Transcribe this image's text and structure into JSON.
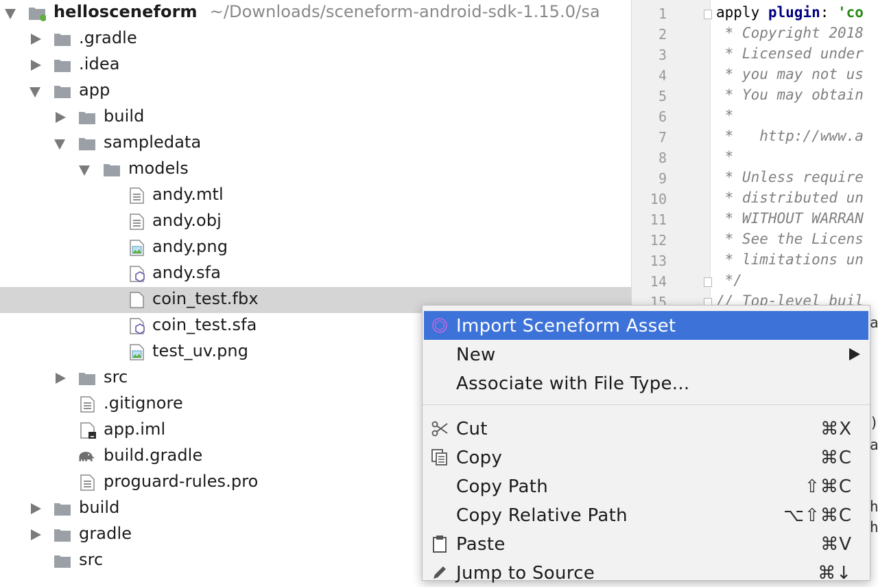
{
  "project_tree": {
    "root": {
      "name": "hellosceneform",
      "path": "~/Downloads/sceneform-android-sdk-1.15.0/sa"
    },
    "items": [
      {
        "label": ".gradle"
      },
      {
        "label": ".idea"
      },
      {
        "label": "app"
      },
      {
        "label": "build"
      },
      {
        "label": "sampledata"
      },
      {
        "label": "models"
      },
      {
        "label": "andy.mtl"
      },
      {
        "label": "andy.obj"
      },
      {
        "label": "andy.png"
      },
      {
        "label": "andy.sfa"
      },
      {
        "label": "coin_test.fbx"
      },
      {
        "label": "coin_test.sfa"
      },
      {
        "label": "test_uv.png"
      },
      {
        "label": "src"
      },
      {
        "label": ".gitignore"
      },
      {
        "label": "app.iml"
      },
      {
        "label": "build.gradle"
      },
      {
        "label": "proguard-rules.pro"
      },
      {
        "label": "build"
      },
      {
        "label": "gradle"
      },
      {
        "label": "src"
      }
    ]
  },
  "editor": {
    "line_numbers": [
      "1",
      "2",
      "3",
      "4",
      "5",
      "6",
      "7",
      "8",
      "9",
      "10",
      "11",
      "12",
      "13",
      "14",
      "15"
    ],
    "lines": [
      {
        "pre": "apply ",
        "kw": "plugin",
        "mid": ": ",
        "str": "'co"
      },
      {
        "text": " * Copyright 2018"
      },
      {
        "text": " * Licensed under"
      },
      {
        "text": " * you may not us"
      },
      {
        "text": " * You may obtain"
      },
      {
        "text": " *"
      },
      {
        "text": " *   http://www.a"
      },
      {
        "text": " *"
      },
      {
        "text": " * Unless require"
      },
      {
        "text": " * distributed un"
      },
      {
        "text": " * WITHOUT WARRAN"
      },
      {
        "text": " * See the Licens"
      },
      {
        "text": " * limitations un"
      },
      {
        "text": " */"
      },
      {
        "text": "// Top-level buil"
      }
    ],
    "fragments": [
      ")",
      "a",
      "h",
      "h",
      "ac"
    ]
  },
  "context_menu": {
    "items": [
      {
        "label": "Import Sceneform Asset",
        "icon": "sceneform-icon",
        "shortcut": ""
      },
      {
        "label": "New",
        "icon": "",
        "shortcut": ""
      },
      {
        "label": "Associate with File Type...",
        "icon": "",
        "shortcut": ""
      },
      {
        "label": "Cut",
        "icon": "scissors-icon",
        "shortcut": "⌘X"
      },
      {
        "label": "Copy",
        "icon": "copy-icon",
        "shortcut": "⌘C"
      },
      {
        "label": "Copy Path",
        "icon": "",
        "shortcut": "⇧⌘C"
      },
      {
        "label": "Copy Relative Path",
        "icon": "",
        "shortcut": "⌥⇧⌘C"
      },
      {
        "label": "Paste",
        "icon": "clipboard-icon",
        "shortcut": "⌘V"
      },
      {
        "label": "Jump to Source",
        "icon": "pencil-icon",
        "shortcut": "⌘↓"
      }
    ]
  },
  "colors": {
    "menu_highlight": "#3d72d8",
    "selected_row": "#d5d5d5",
    "folder": "#9aa0a6",
    "string": "#2c8a19",
    "keyword": "#000080"
  }
}
